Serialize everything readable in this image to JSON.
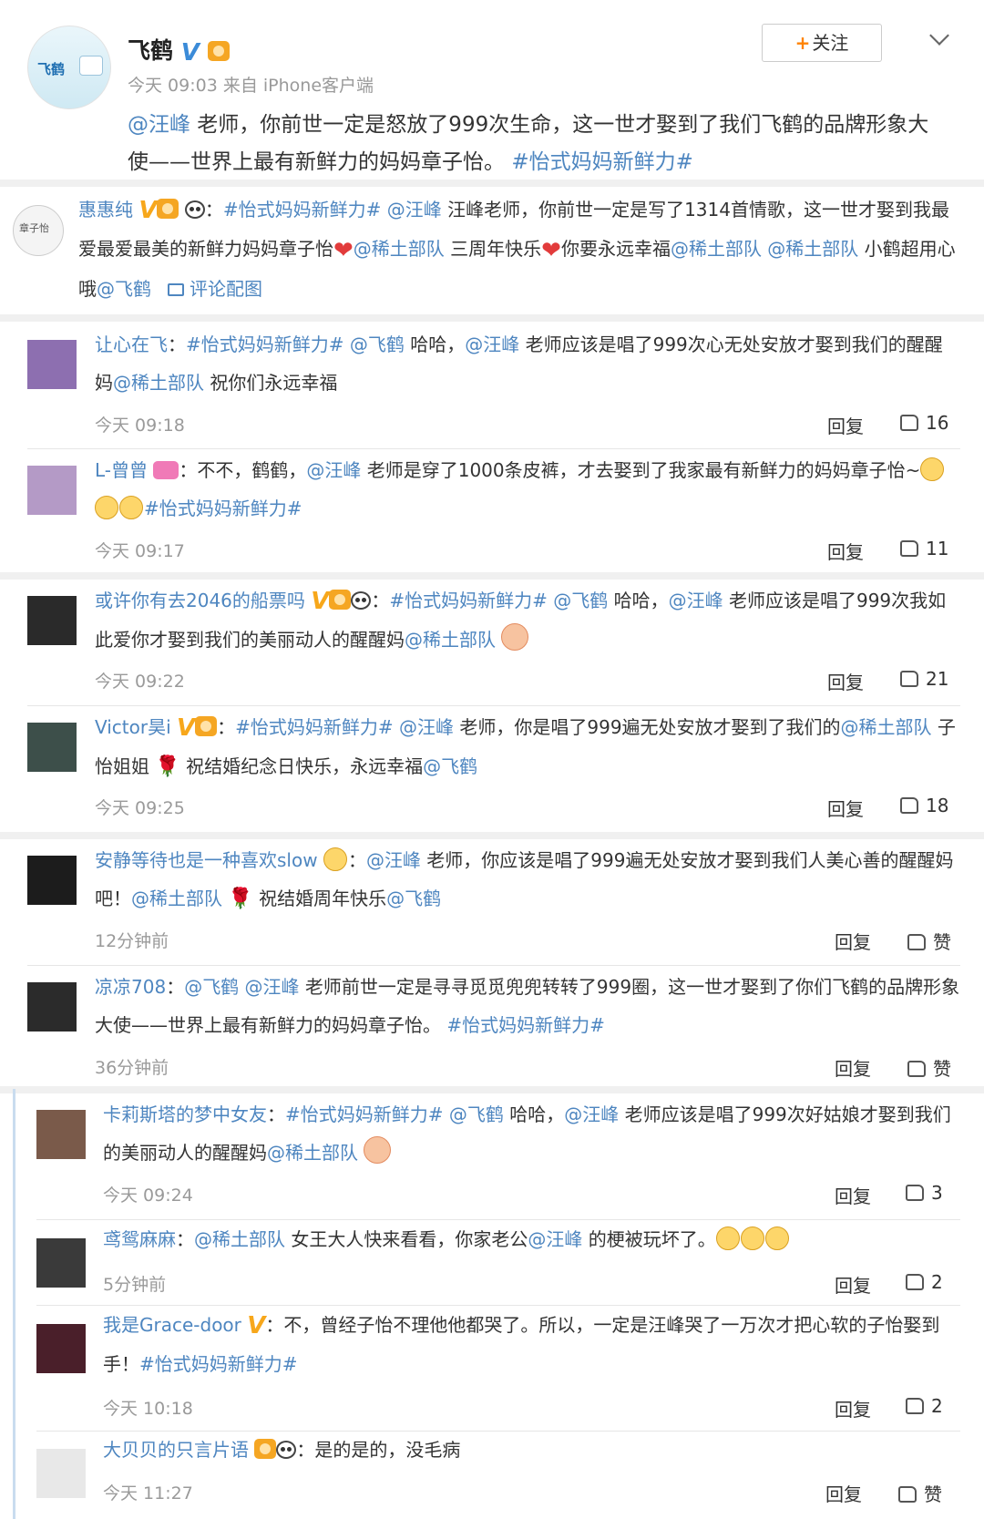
{
  "post": {
    "author": "飞鹤",
    "avatar_text": "飞鹤",
    "meta": "今天 09:03 来自 iPhone客户端",
    "follow_label": "关注",
    "text_mention": "@汪峰",
    "text_body": " 老师，你前世一定是怒放了999次生命，这一世才娶到了我们飞鹤的品牌形象大使——世界上最有新鲜力的妈妈章子怡。",
    "text_tag": "#怡式妈妈新鲜力#"
  },
  "comments": [
    {
      "name": "惠惠纯",
      "text_a": "#怡式妈妈新鲜力# @汪峰",
      "text_b": " 汪峰老师，你前世一定是写了1314首情歌，这一世才娶到我最爱最爱最美的新鲜力妈妈章子怡",
      "text_c": "@稀土部队",
      "text_d": " 三周年快乐",
      "text_e": "你要永远幸福",
      "text_f": "@稀土部队 @稀土部队",
      "text_g": " 小鹤超用心哦",
      "text_h": "@飞鹤",
      "pic_label": "评论配图",
      "avatar_label": "章子怡"
    },
    {
      "name": "让心在飞",
      "text_a": "#怡式妈妈新鲜力# @飞鹤",
      "text_b": " 哈哈，",
      "text_c": "@汪峰",
      "text_d": " 老师应该是唱了999次心无处安放才娶到我们的醒醒妈",
      "text_e": "@稀土部队",
      "text_f": " 祝你们永远幸福",
      "time": "今天 09:18",
      "reply": "回复",
      "likes": "16"
    },
    {
      "name": "L-曾曾",
      "text_a": "：不不，鹤鹤，",
      "text_b": "@汪峰",
      "text_c": " 老师是穿了1000条皮裤，才去娶到了我家最有新鲜力的妈妈章子怡~",
      "text_d": "#怡式妈妈新鲜力#",
      "time": "今天 09:17",
      "reply": "回复",
      "likes": "11"
    },
    {
      "name": "或许你有去2046的船票吗",
      "text_a": "#怡式妈妈新鲜力# @飞鹤",
      "text_b": " 哈哈，",
      "text_c": "@汪峰",
      "text_d": " 老师应该是唱了999次我如此爱你才娶到我们的美丽动人的醒醒妈",
      "text_e": "@稀土部队",
      "time": "今天 09:22",
      "reply": "回复",
      "likes": "21"
    },
    {
      "name": "Victor昊i",
      "text_a": "#怡式妈妈新鲜力# @汪峰",
      "text_b": " 老师，你是唱了999遍无处安放才娶到了我们的",
      "text_c": "@稀土部队",
      "text_d": " 子怡姐姐",
      "text_e": "祝结婚纪念日快乐，永远幸福",
      "text_f": "@飞鹤",
      "time": "今天 09:25",
      "reply": "回复",
      "likes": "18"
    },
    {
      "name": "安静等待也是一种喜欢slow",
      "text_a": "@汪峰",
      "text_b": " 老师，你应该是唱了999遍无处安放才娶到我们人美心善的醒醒妈吧！",
      "text_c": "@稀土部队",
      "text_d": "祝结婚周年快乐",
      "text_e": "@飞鹤",
      "time": "12分钟前",
      "reply": "回复",
      "likes": "赞"
    },
    {
      "name": "凉凉708",
      "text_a": "@飞鹤 @汪峰",
      "text_b": " 老师前世一定是寻寻觅觅兜兜转转了999圈，这一世才娶到了你们飞鹤的品牌形象大使——世界上最有新鲜力的妈妈章子怡。",
      "text_c": "#怡式妈妈新鲜力#",
      "time": "36分钟前",
      "reply": "回复",
      "likes": "赞"
    },
    {
      "name": "卡莉斯塔的梦中女友",
      "text_a": "#怡式妈妈新鲜力# @飞鹤",
      "text_b": " 哈哈，",
      "text_c": "@汪峰",
      "text_d": " 老师应该是唱了999次好姑娘才娶到我们的美丽动人的醒醒妈",
      "text_e": "@稀土部队",
      "time": "今天 09:24",
      "reply": "回复",
      "likes": "3"
    },
    {
      "name": "鸢鸳麻麻",
      "text_a": "@稀土部队",
      "text_b": " 女王大人快来看看，你家老公",
      "text_c": "@汪峰",
      "text_d": " 的梗被玩坏了。",
      "time": "5分钟前",
      "reply": "回复",
      "likes": "2"
    },
    {
      "name": "我是Grace-door",
      "text_a": "：不，曾经子怡不理他他都哭了。所以，一定是汪峰哭了一万次才把心软的子怡娶到手！",
      "text_b": "#怡式妈妈新鲜力#",
      "time": "今天 10:18",
      "reply": "回复",
      "likes": "2"
    },
    {
      "name": "大贝贝的只言片语",
      "text_a": "：是的是的，没毛病",
      "time": "今天 11:27",
      "reply": "回复",
      "likes": "赞"
    }
  ],
  "colors": {
    "link": "#4e86c0",
    "accent": "#ff8200",
    "vip": "#f7a71b",
    "verified": "#3b8bd8"
  },
  "icons": [
    "verified-v-icon",
    "level-badge-icon",
    "panda-icon",
    "heart-icon",
    "rose-icon",
    "thumb-up-icon",
    "picture-icon",
    "chevron-down-icon",
    "plus-icon"
  ]
}
